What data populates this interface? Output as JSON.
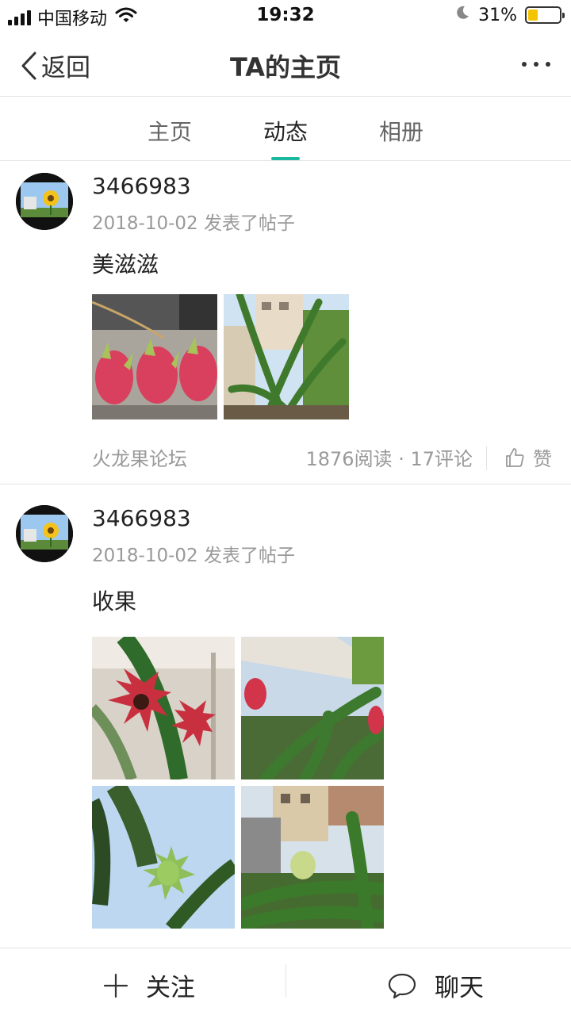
{
  "status_bar": {
    "carrier": "中国移动",
    "time": "19:32",
    "battery_text": "31%",
    "battery_level": 0.31,
    "icons": [
      "signal-icon",
      "wifi-icon",
      "moon-icon",
      "battery-icon"
    ]
  },
  "nav": {
    "back_label": "返回",
    "title": "TA的主页",
    "more_icon": "more-icon"
  },
  "tabs": [
    {
      "label": "主页",
      "active": false
    },
    {
      "label": "动态",
      "active": true
    },
    {
      "label": "相册",
      "active": false
    }
  ],
  "posts": [
    {
      "username": "3466983",
      "date": "2018-10-02",
      "action": "发表了帖子",
      "meta": "2018-10-02 发表了帖子",
      "text": "美滋滋",
      "photo_count": 2,
      "forum": "火龙果论坛",
      "stats": "1876阅读 · 17评论",
      "reads": 1876,
      "comments": 17,
      "like_label": "赞"
    },
    {
      "username": "3466983",
      "date": "2018-10-02",
      "action": "发表了帖子",
      "meta": "2018-10-02 发表了帖子",
      "text": "收果",
      "photo_count": 4
    }
  ],
  "bottom_bar": {
    "follow_label": "关注",
    "chat_label": "聊天"
  },
  "colors": {
    "accent": "#1bb8a0",
    "battery": "#f5c400",
    "muted_text": "#999999"
  }
}
